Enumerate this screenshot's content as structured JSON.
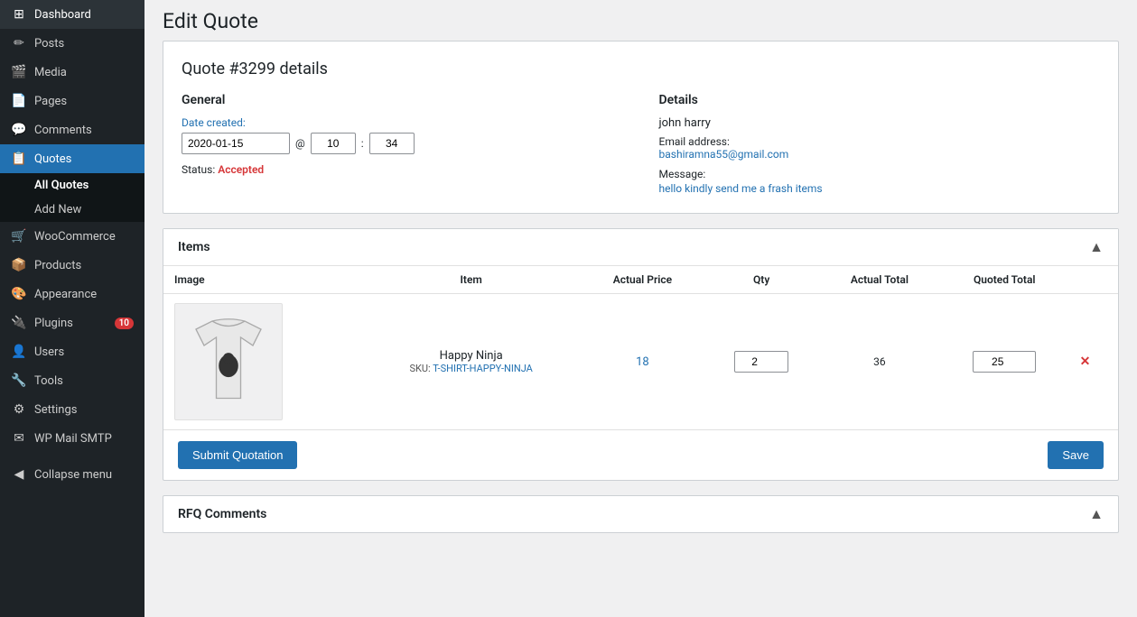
{
  "page": {
    "title": "Edit Quote"
  },
  "sidebar": {
    "items": [
      {
        "id": "dashboard",
        "icon": "⊞",
        "label": "Dashboard"
      },
      {
        "id": "posts",
        "icon": "📝",
        "label": "Posts"
      },
      {
        "id": "media",
        "icon": "🎬",
        "label": "Media"
      },
      {
        "id": "pages",
        "icon": "📄",
        "label": "Pages"
      },
      {
        "id": "comments",
        "icon": "💬",
        "label": "Comments"
      },
      {
        "id": "quotes",
        "icon": "📋",
        "label": "Quotes",
        "active": true
      },
      {
        "id": "woocommerce",
        "icon": "🛒",
        "label": "WooCommerce"
      },
      {
        "id": "products",
        "icon": "📦",
        "label": "Products"
      },
      {
        "id": "appearance",
        "icon": "🎨",
        "label": "Appearance"
      },
      {
        "id": "plugins",
        "icon": "🔌",
        "label": "Plugins",
        "badge": "10"
      },
      {
        "id": "users",
        "icon": "👤",
        "label": "Users"
      },
      {
        "id": "tools",
        "icon": "🔧",
        "label": "Tools"
      },
      {
        "id": "settings",
        "icon": "⚙",
        "label": "Settings"
      },
      {
        "id": "wp-mail-smtp",
        "icon": "✉",
        "label": "WP Mail SMTP"
      }
    ],
    "submenu": {
      "all_quotes": "All Quotes",
      "add_new": "Add New"
    },
    "collapse_label": "Collapse menu"
  },
  "quote_details": {
    "title": "Quote #3299 details",
    "general": {
      "section_label": "General",
      "date_label": "Date created:",
      "date_value": "2020-01-15",
      "time_hour": "10",
      "time_minute": "34",
      "at_separator": "@",
      "colon_separator": ":",
      "status_prefix": "Status:",
      "status_value": "Accepted"
    },
    "details": {
      "section_label": "Details",
      "customer_name": "john harry",
      "email_label": "Email address:",
      "email_value": "bashiramna55@gmail.com",
      "message_label": "Message:",
      "message_value": "hello kindly send me a frash items"
    }
  },
  "items_section": {
    "title": "Items",
    "columns": {
      "image": "Image",
      "item": "Item",
      "actual_price": "Actual Price",
      "qty": "Qty",
      "actual_total": "Actual Total",
      "quoted_total": "Quoted Total"
    },
    "rows": [
      {
        "product_name": "Happy Ninja",
        "sku_label": "SKU:",
        "sku_value": "T-SHIRT-HAPPY-NINJA",
        "actual_price": "18",
        "qty": "2",
        "actual_total": "36",
        "quoted_total": "25"
      }
    ],
    "submit_button": "Submit Quotation",
    "save_button": "Save"
  },
  "rfq_comments": {
    "title": "RFQ Comments"
  }
}
